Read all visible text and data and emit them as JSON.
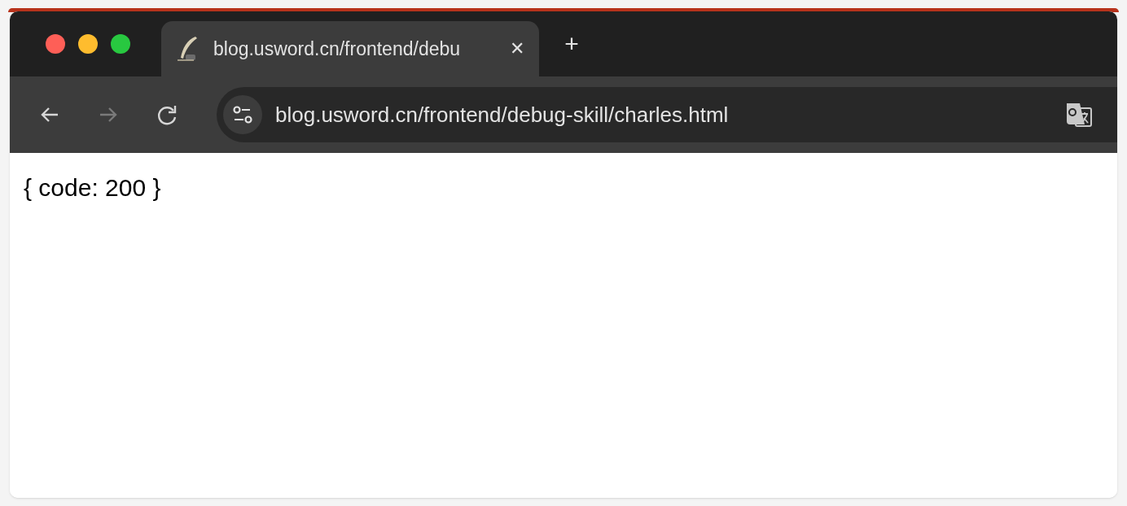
{
  "tabs": [
    {
      "title": "blog.usword.cn/frontend/debu",
      "selected": true,
      "close": "✕"
    }
  ],
  "new_tab": "+",
  "nav_buttons": [
    {
      "kind": "back",
      "disabled": false
    },
    {
      "kind": "forward",
      "disabled": true
    },
    {
      "kind": "reload",
      "disabled": false
    }
  ],
  "address_bar": {
    "value": "blog.usword.cn/frontend/debug-skill/charles.html"
  },
  "page": {
    "body_text": "{ code: 200 }"
  }
}
